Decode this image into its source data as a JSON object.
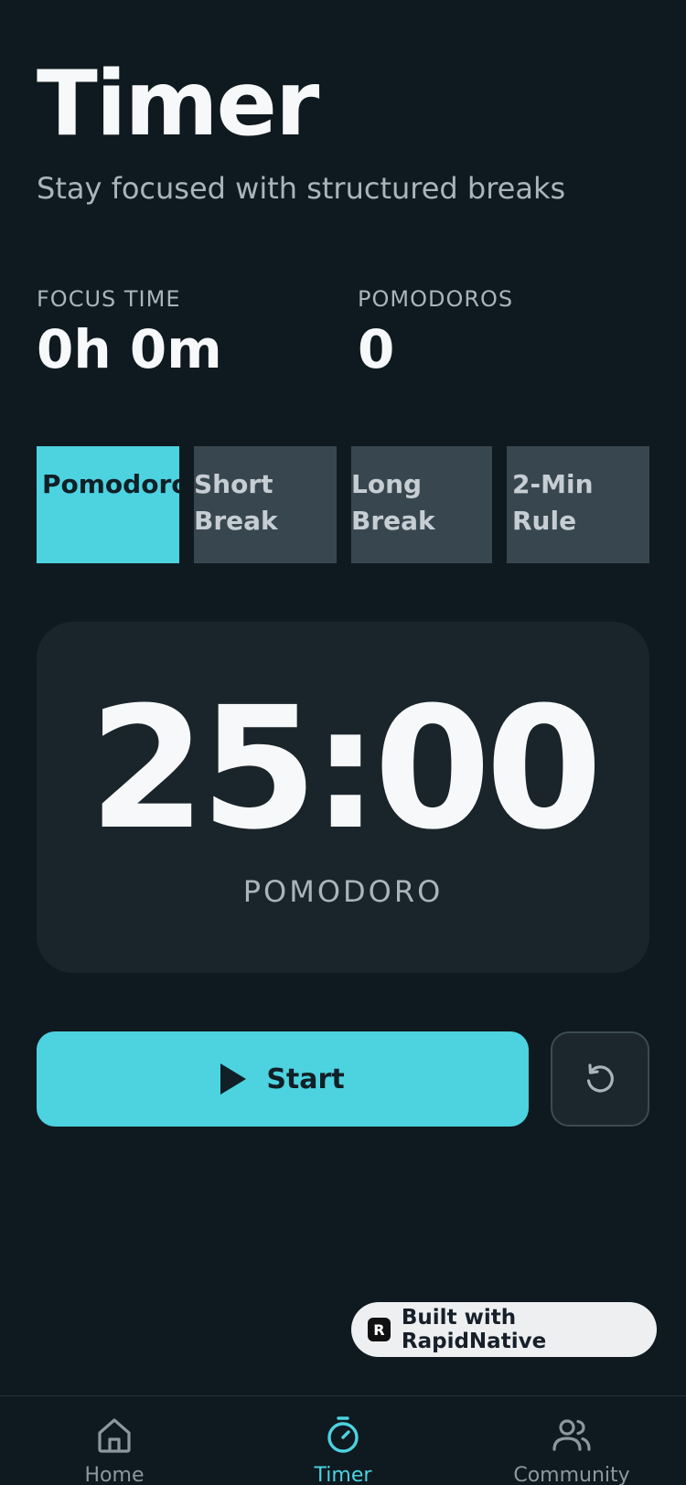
{
  "header": {
    "title": "Timer",
    "subtitle": "Stay focused with structured breaks"
  },
  "stats": {
    "focus_label": "FOCUS TIME",
    "focus_value": "0h 0m",
    "pomodoros_label": "POMODOROS",
    "pomodoros_value": "0"
  },
  "modes": [
    {
      "label": "Pomodoro",
      "active": true
    },
    {
      "label": "Short Break",
      "line1": "Short",
      "line2": "Break",
      "active": false
    },
    {
      "label": "Long Break",
      "line1": "Long",
      "line2": "Break",
      "active": false
    },
    {
      "label": "2-Min Rule",
      "active": false
    }
  ],
  "timer": {
    "display": "25:00",
    "mode_label": "POMODORO"
  },
  "controls": {
    "start_label": "Start",
    "play_icon": "play-icon",
    "reset_icon": "reset-icon"
  },
  "badge": {
    "text": "Built with RapidNative",
    "logo_letter": "R"
  },
  "tabbar": {
    "items": [
      {
        "label": "Home",
        "icon": "home-icon",
        "active": false
      },
      {
        "label": "Timer",
        "icon": "timer-icon",
        "active": true
      },
      {
        "label": "Community",
        "icon": "community-icon",
        "active": false
      }
    ]
  },
  "colors": {
    "accent": "#4dd2e0",
    "background": "#0f1a20",
    "card": "#1a242b",
    "inactive_mode": "#38474f"
  }
}
